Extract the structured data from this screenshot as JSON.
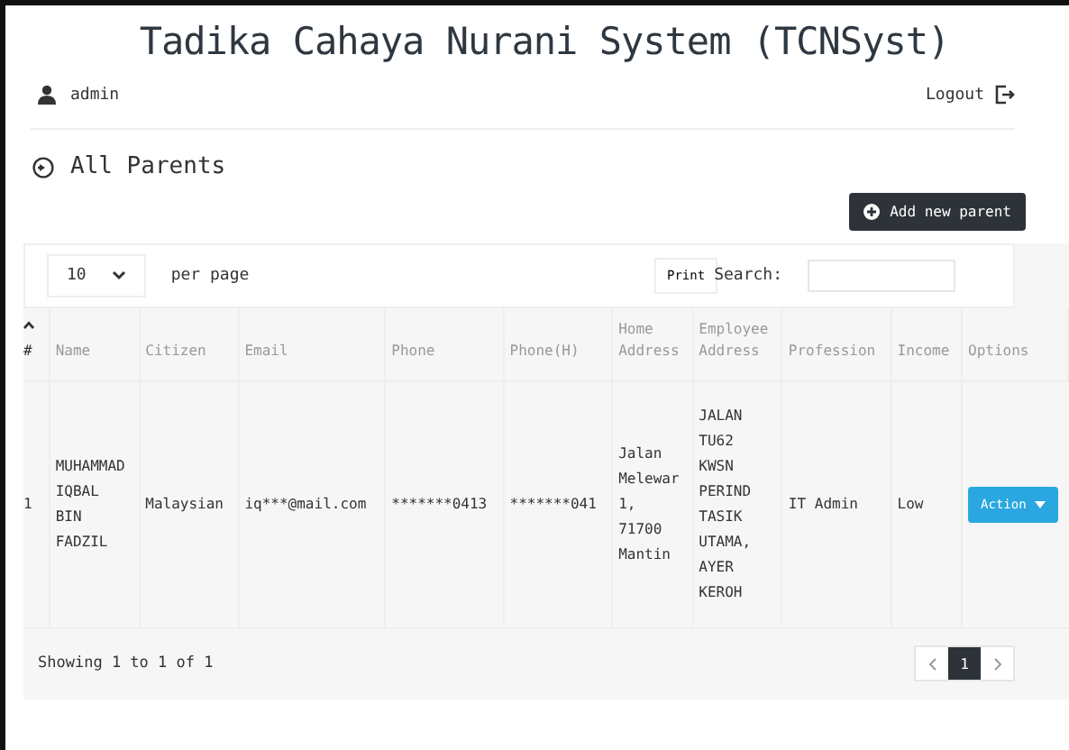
{
  "app_title": "Tadika Cahaya Nurani System (TCNSyst)",
  "user": {
    "name": "admin"
  },
  "logout": {
    "label": "Logout"
  },
  "page_title": "All Parents",
  "add_button": {
    "label": "Add new parent"
  },
  "table_controls": {
    "page_size": "10",
    "per_page_label": "per page",
    "print_label": "Print",
    "search_label": "Search:"
  },
  "table": {
    "columns": [
      {
        "label": "#",
        "sorted": true
      },
      {
        "label": "Name",
        "sorted": false
      },
      {
        "label": "Citizen",
        "sorted": false
      },
      {
        "label": "Email",
        "sorted": false
      },
      {
        "label": "Phone",
        "sorted": false
      },
      {
        "label": "Phone(H)",
        "sorted": false
      },
      {
        "label": "Home Address",
        "sorted": false
      },
      {
        "label": "Employee Address",
        "sorted": false
      },
      {
        "label": "Profession",
        "sorted": false
      },
      {
        "label": "Income",
        "sorted": false
      },
      {
        "label": "Options",
        "sorted": false
      }
    ],
    "rows": [
      {
        "cells": [
          "1",
          "MUHAMMAD IQBAL BIN FADZIL",
          "Malaysian",
          "iq***@mail.com",
          "*******0413",
          "*******041",
          "Jalan Melewar 1, 71700 Mantin",
          "JALAN TU62 KWSN PERIND TASIK UTAMA, AYER KEROH",
          "IT Admin",
          "Low"
        ],
        "action": "Action"
      }
    ]
  },
  "footer": {
    "summary": "Showing 1 to 1 of 1",
    "pages": [
      {
        "label": "1",
        "selected": true
      }
    ]
  }
}
